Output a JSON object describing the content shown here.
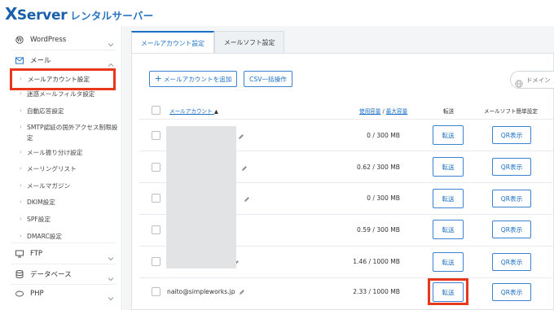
{
  "header": {
    "logo_x": "X",
    "logo_server": "Server",
    "logo_sub": "レンタルサーバー"
  },
  "sidebar": {
    "groups": [
      {
        "label": "WordPress",
        "icon": "wordpress-icon"
      },
      {
        "label": "メール",
        "icon": "mail-icon"
      },
      {
        "label": "FTP",
        "icon": "ftp-icon"
      },
      {
        "label": "データベース",
        "icon": "database-icon"
      },
      {
        "label": "PHP",
        "icon": "php-icon"
      }
    ],
    "mail_items": [
      "メールアカウント設定",
      "迷惑メールフィルタ設定",
      "自動応答設定",
      "SMTP認証の国外アクセス制限設定",
      "メール振り分け設定",
      "メーリングリスト",
      "メールマガジン",
      "DKIM設定",
      "SPF設定",
      "DMARC設定"
    ]
  },
  "tabs": [
    "メールアカウント設定",
    "メールソフト設定"
  ],
  "toolbar": {
    "add_label": "メールアカウントを追加",
    "csv_label": "CSV一括操作",
    "search_placeholder": "ドメイン"
  },
  "table": {
    "col_account": "メールアカウント",
    "sort_indicator": "▲",
    "col_used": "使用容量",
    "col_separator": " / ",
    "col_max": "最大容量",
    "col_forward": "転送",
    "col_mailsoft": "メールソフト簡単設定",
    "rows": [
      {
        "account": "",
        "usage": "0 / 300 MB",
        "forward": "転送",
        "qr": "QR表示"
      },
      {
        "account": "",
        "usage": "0.62 / 300 MB",
        "forward": "転送",
        "qr": "QR表示"
      },
      {
        "account": "",
        "usage": "0 / 300 MB",
        "forward": "転送",
        "qr": "QR表示"
      },
      {
        "account": "",
        "usage": "0.59 / 300 MB",
        "forward": "転送",
        "qr": "QR表示"
      },
      {
        "account": "",
        "usage": "1.46 / 1000 MB",
        "forward": "転送",
        "qr": "QR表示"
      },
      {
        "account": "naito@simpleworks.jp",
        "usage": "2.33 / 1000 MB",
        "forward": "転送",
        "qr": "QR表示"
      }
    ]
  },
  "colors": {
    "brand": "#1a5fa9",
    "accent": "#1a6fc4",
    "highlight": "#e8371b"
  }
}
